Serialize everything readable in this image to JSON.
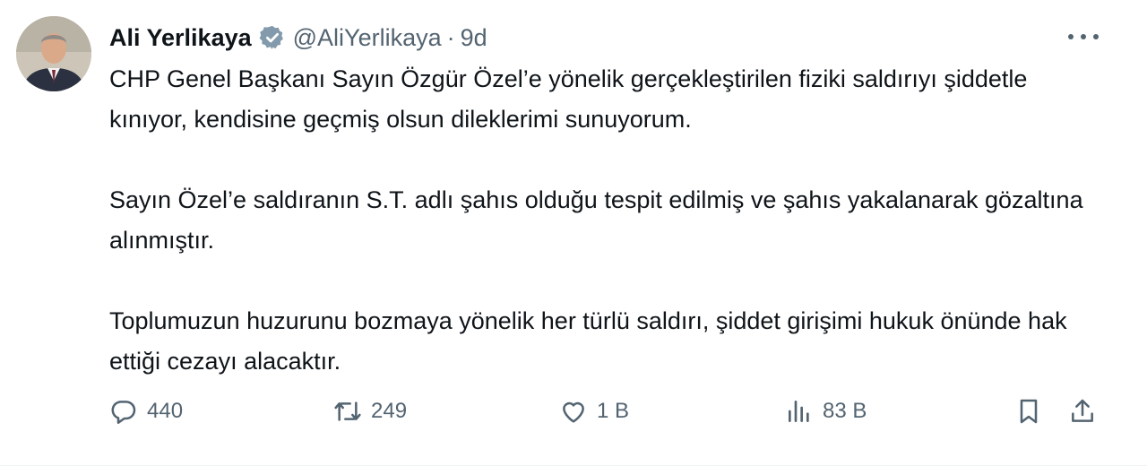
{
  "author": {
    "name": "Ali Yerlikaya",
    "handle": "@AliYerlikaya",
    "separator": "·",
    "time": "9d",
    "verified_color": "#829aab"
  },
  "tweet": {
    "paragraphs": [
      "CHP Genel Başkanı Sayın Özgür Özel’e yönelik gerçekleştirilen fiziki saldırıyı şiddetle kınıyor, kendisine geçmiş olsun dileklerimi sunuyorum.",
      "Sayın Özel’e saldıranın S.T. adlı şahıs olduğu tespit edilmiş ve şahıs yakalanarak gözaltına alınmıştır.",
      "Toplumuzun huzurunu bozmaya yönelik her türlü saldırı, şiddet girişimi hukuk önünde hak ettiği cezayı alacaktır."
    ]
  },
  "actions": {
    "reply": {
      "icon": "reply-icon",
      "count": "440"
    },
    "retweet": {
      "icon": "retweet-icon",
      "count": "249"
    },
    "like": {
      "icon": "heart-icon",
      "count": "1 B"
    },
    "views": {
      "icon": "views-icon",
      "count": "83 B"
    },
    "bookmark": {
      "icon": "bookmark-icon"
    },
    "share": {
      "icon": "share-icon"
    }
  },
  "colors": {
    "text": "#0f1419",
    "secondary": "#536471"
  }
}
